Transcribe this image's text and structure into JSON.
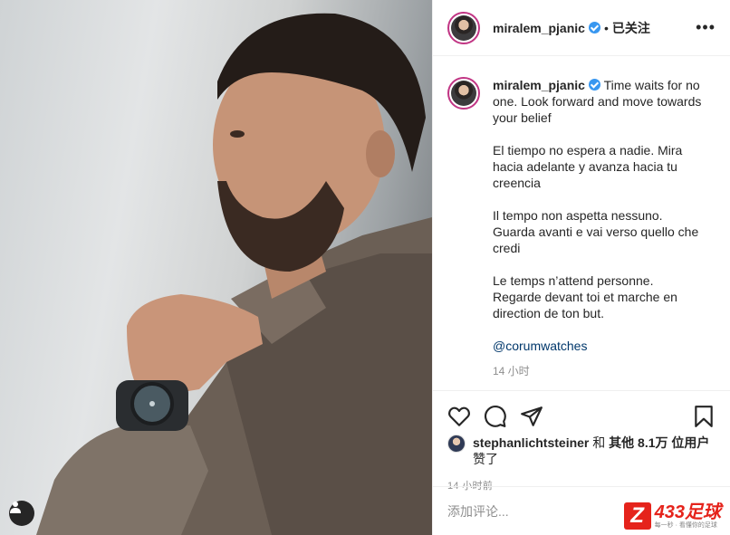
{
  "post": {
    "username": "miralem_pjanic",
    "separator": "•",
    "follow_status": "已关注",
    "more_icon": "more-horizontal-icon"
  },
  "caption": {
    "username": "miralem_pjanic",
    "para1": "Time waits for no one. Look forward and move towards your belief",
    "para2": "El tiempo no espera a nadie. Mira hacia adelante y avanza hacia tu creencia",
    "para3": "Il tempo non aspetta nessuno. Guarda avanti e vai verso quello che credi",
    "para4": "Le temps n’attend personne. Regarde devant toi et marche en direction de ton but.",
    "mention": "@corumwatches",
    "time": "14 小时"
  },
  "actions": {
    "like_icon": "heart-icon",
    "comment_icon": "comment-icon",
    "share_icon": "share-icon",
    "save_icon": "bookmark-icon"
  },
  "likes": {
    "user": "stephanlichtsteiner",
    "and": " 和 ",
    "others": "其他 8.1万 位用户",
    "liked": "赞了"
  },
  "post_time": "14 小时前",
  "comment": {
    "placeholder": "添加评论..."
  },
  "watermark": {
    "logo_letter": "Z",
    "title": "433足球",
    "subtitle": "每一秒 · 看懂你的足球"
  },
  "colors": {
    "verified": "#3897f0",
    "link": "#00376b",
    "muted": "#8e8e8e",
    "watermark_red": "#e5231b"
  }
}
